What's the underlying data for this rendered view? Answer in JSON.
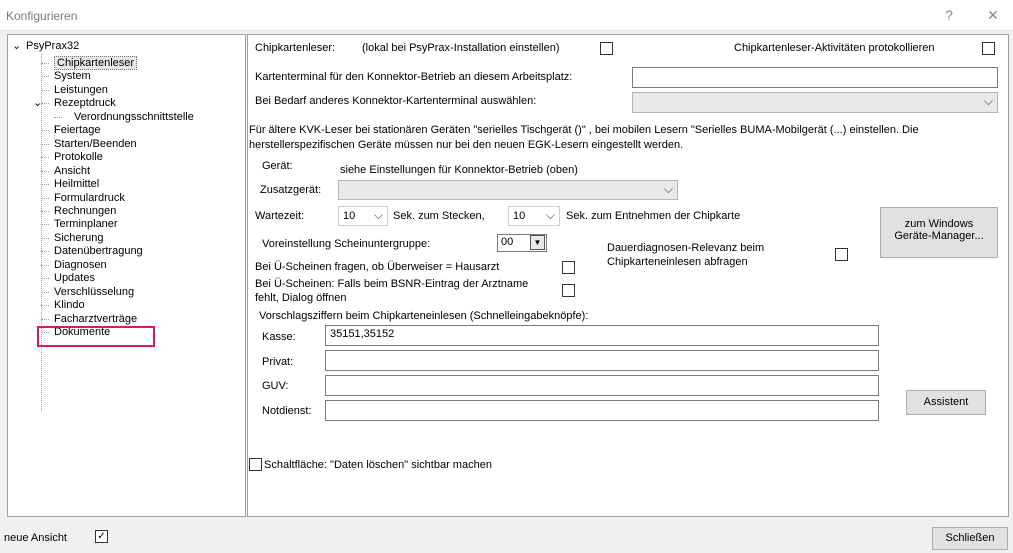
{
  "window": {
    "title": "Konfigurieren",
    "help_label": "?",
    "close_label": "✕"
  },
  "tree": {
    "root": "PsyPrax32",
    "items": [
      {
        "label": "Chipkartenleser",
        "selected": true
      },
      {
        "label": "System"
      },
      {
        "label": "Leistungen"
      },
      {
        "label": "Rezeptdruck",
        "expanded": true
      },
      {
        "label": "Verordnungsschnittstelle",
        "child": true
      },
      {
        "label": "Feiertage"
      },
      {
        "label": "Starten/Beenden"
      },
      {
        "label": "Protokolle"
      },
      {
        "label": "Ansicht"
      },
      {
        "label": "Heilmittel"
      },
      {
        "label": "Formulardruck"
      },
      {
        "label": "Rechnungen"
      },
      {
        "label": "Terminplaner"
      },
      {
        "label": "Sicherung"
      },
      {
        "label": "Datenübertragung"
      },
      {
        "label": "Diagnosen"
      },
      {
        "label": "Updates",
        "highlighted": true
      },
      {
        "label": "Verschlüsselung"
      },
      {
        "label": "Klindo"
      },
      {
        "label": "Facharztverträge"
      },
      {
        "label": "Dokumente"
      }
    ]
  },
  "settings": {
    "reader_label": "Chipkartenleser:",
    "reader_hint": "(lokal bei PsyPrax-Installation einstellen)",
    "log_label": "Chipkartenleser-Aktivitäten protokollieren",
    "terminal_label": "Kartenterminal für den Konnektor-Betrieb an diesem Arbeitsplatz:",
    "terminal_value": "",
    "other_terminal_label": "Bei Bedarf anderes Konnektor-Kartenterminal auswählen:",
    "other_terminal_value": "",
    "kvk_note_line1": "Für ältere KVK-Leser bei stationären Geräten \"serielles Tischgerät ()\" , bei mobilen Lesern \"Serielles BUMA-Mobilgerät (...) einstellen. Die",
    "kvk_note_line2": "herstellerspezifischen Geräte müssen nur bei den neuen EGK-Lesern eingestellt werden.",
    "device_label": "Gerät:",
    "device_value": "siehe Einstellungen für Konnektor-Betrieb (oben)",
    "extra_device_label": "Zusatzgerät:",
    "extra_device_value": "",
    "wait_label": "Wartezeit:",
    "wait_insert_value": "10",
    "wait_insert_suffix": "Sek. zum Stecken,",
    "wait_remove_value": "10",
    "wait_remove_suffix": "Sek. zum Entnehmen der Chipkarte",
    "device_manager_line1": "zum Windows",
    "device_manager_line2": "Geräte-Manager...",
    "subgroup_label": "Voreinstellung Scheinuntergruppe:",
    "subgroup_value": "00",
    "permanent_diag_line1": "Dauerdiagnosen-Relevanz beim",
    "permanent_diag_line2": "Chipkarteneinlesen abfragen",
    "referral_label": "Bei Ü-Scheinen fragen, ob Überweiser = Hausarzt",
    "bsnr_line1": "Bei Ü-Scheinen: Falls beim BSNR-Eintrag der Arztname",
    "bsnr_line2": "fehlt, Dialog öffnen",
    "shortcuts_label": "Vorschlagsziffern beim Chipkarteneinlesen (Schnelleingabeknöpfe):",
    "kasse_label": "Kasse:",
    "kasse_value": "35151,35152",
    "privat_label": "Privat:",
    "privat_value": "",
    "guv_label": "GUV:",
    "guv_value": "",
    "notdienst_label": "Notdienst:",
    "notdienst_value": "",
    "assistant_label": "Assistent",
    "delete_button_label": "Schaltfläche: \"Daten löschen\" sichtbar machen"
  },
  "footer": {
    "new_view_label": "neue Ansicht",
    "new_view_checked": true,
    "close_label": "Schließen"
  }
}
